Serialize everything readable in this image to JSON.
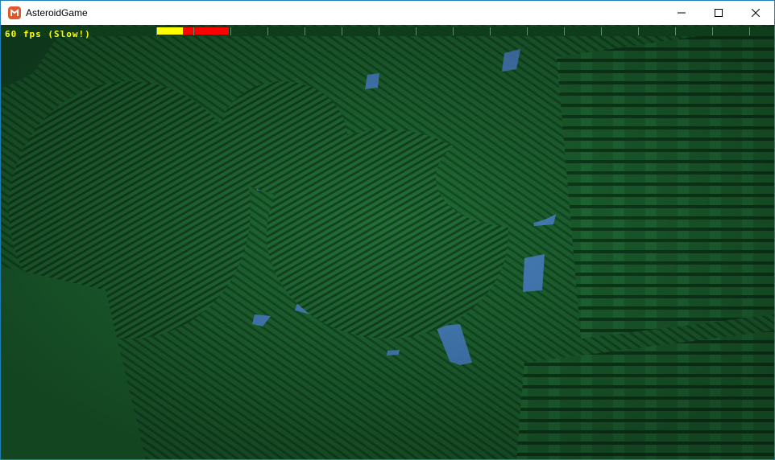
{
  "window": {
    "title": "AsteroidGame",
    "app_icon": "monogame-icon",
    "controls": [
      "minimize-icon",
      "maximize-icon",
      "close-icon"
    ]
  },
  "hud": {
    "fps_text": "60 fps (Slow!)",
    "fps_color": "#ffff00",
    "perf_bar": {
      "segments": [
        {
          "color": "#ffff00",
          "fraction": 0.043
        },
        {
          "color": "#ff0000",
          "fraction": 0.074
        }
      ],
      "tick_count": 17
    }
  },
  "scene": {
    "description_colors": {
      "voxel_green": "#1f6b33",
      "shadow_green": "#0f3d1b",
      "sky_blue": "#4a86c5"
    }
  }
}
